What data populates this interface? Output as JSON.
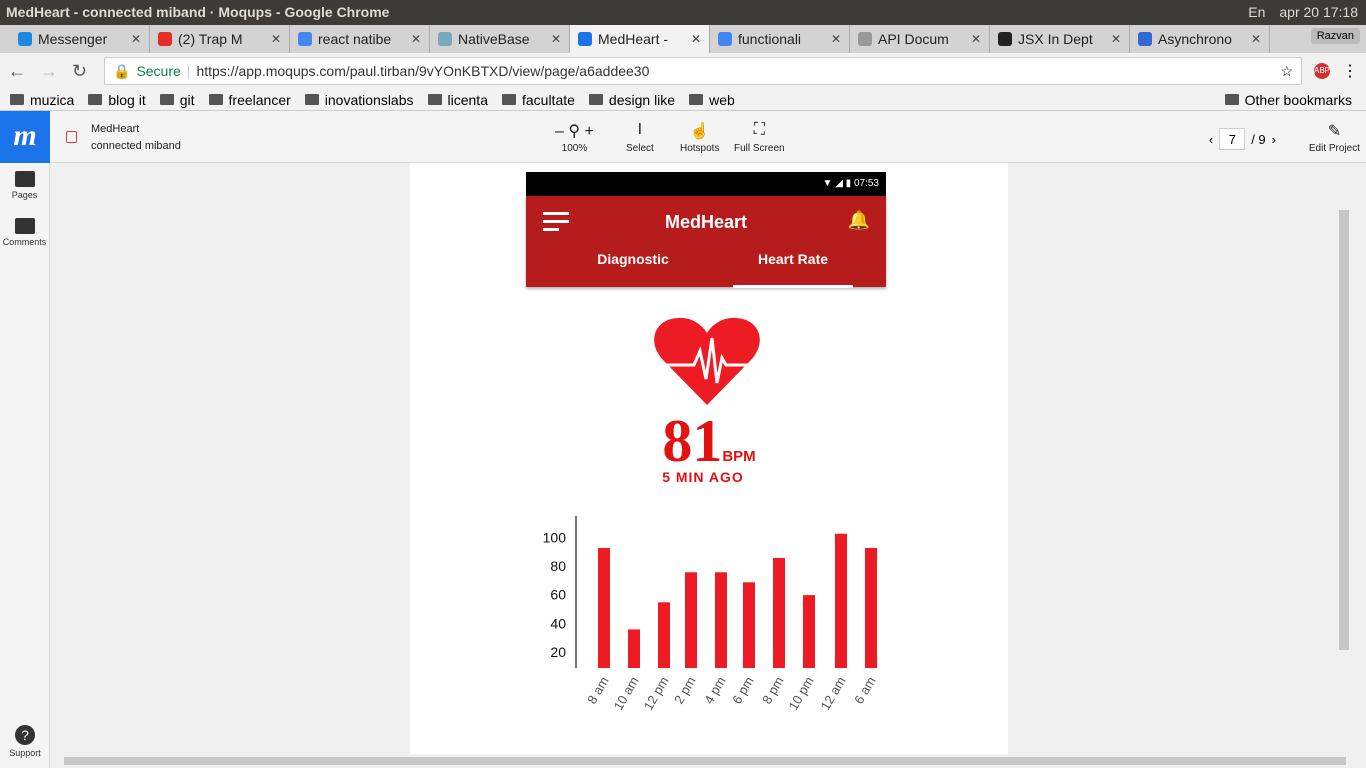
{
  "window": {
    "title": "MedHeart - connected miband · Moqups - Google Chrome",
    "clock": "apr 20 17:18",
    "keyboard": "En"
  },
  "tabs": [
    {
      "label": "Messenger",
      "color": "#1e88e5"
    },
    {
      "label": "(2) Trap M",
      "color": "#e52d27"
    },
    {
      "label": "react natibe",
      "color": "#4285f4"
    },
    {
      "label": "NativeBase",
      "color": "#7ab"
    },
    {
      "label": "MedHeart -",
      "color": "#1a73e8"
    },
    {
      "label": "functionali",
      "color": "#4285f4"
    },
    {
      "label": "API Docum",
      "color": "#999"
    },
    {
      "label": "JSX In Dept",
      "color": "#222"
    },
    {
      "label": "Asynchrono",
      "color": "#3367d6"
    }
  ],
  "profile": "Razvan",
  "omnibox": {
    "secure": "Secure",
    "url": "https://app.moqups.com/paul.tirban/9vYOnKBTXD/view/page/a6addee30"
  },
  "bookmarks": [
    "muzica",
    "blog it",
    "git",
    "freelancer",
    "inovationslabs",
    "licenta",
    "facultate",
    "design like",
    "web"
  ],
  "other_bookmarks": "Other bookmarks",
  "moqups": {
    "logo": "m",
    "project": "MedHeart",
    "page": "connected miband",
    "zoom": "100%",
    "select": "Select",
    "hotspots": "Hotspots",
    "fullscreen": "Full Screen",
    "current_page": "7",
    "total_pages": "/ 9",
    "edit": "Edit Project"
  },
  "sidebar": {
    "pages": "Pages",
    "comments": "Comments",
    "support": "Support"
  },
  "app": {
    "time": "07:53",
    "title": "MedHeart",
    "tab1": "Diagnostic",
    "tab2": "Heart Rate",
    "bpm": "81",
    "unit": "BPM",
    "ago": "5 MIN AGO",
    "accent": "#b71c1c",
    "heart_color": "#ed1c24"
  },
  "chart_data": {
    "type": "bar",
    "categories": [
      "8 am",
      "10 am",
      "12 pm",
      "2 pm",
      "4 pm",
      "6 pm",
      "8 pm",
      "10 pm",
      "12 am",
      "6 am"
    ],
    "values": [
      92,
      35,
      54,
      75,
      75,
      68,
      85,
      59,
      102,
      92
    ],
    "yticks": [
      20,
      40,
      60,
      80,
      100
    ],
    "ylim": [
      8,
      120
    ],
    "color": "#ed1c24"
  }
}
